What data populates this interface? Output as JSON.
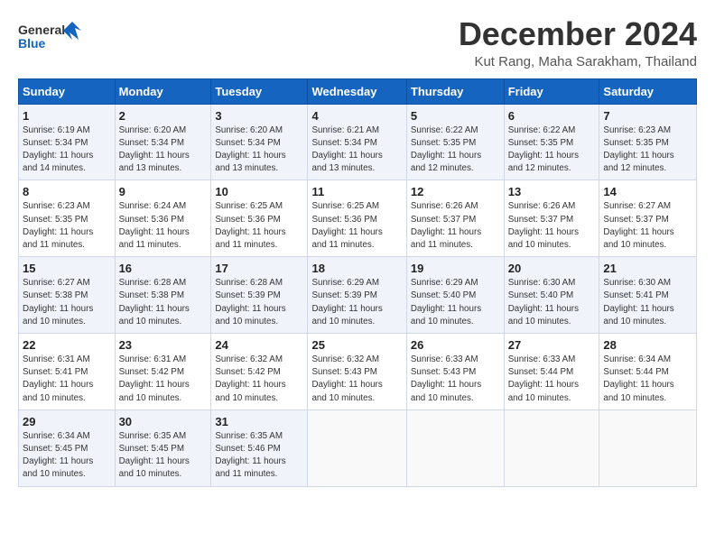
{
  "logo": {
    "line1": "General",
    "line2": "Blue"
  },
  "title": "December 2024",
  "subtitle": "Kut Rang, Maha Sarakham, Thailand",
  "headers": [
    "Sunday",
    "Monday",
    "Tuesday",
    "Wednesday",
    "Thursday",
    "Friday",
    "Saturday"
  ],
  "weeks": [
    [
      {
        "day": "1",
        "rise": "6:19 AM",
        "set": "5:34 PM",
        "daylight": "11 hours and 14 minutes."
      },
      {
        "day": "2",
        "rise": "6:20 AM",
        "set": "5:34 PM",
        "daylight": "11 hours and 13 minutes."
      },
      {
        "day": "3",
        "rise": "6:20 AM",
        "set": "5:34 PM",
        "daylight": "11 hours and 13 minutes."
      },
      {
        "day": "4",
        "rise": "6:21 AM",
        "set": "5:34 PM",
        "daylight": "11 hours and 13 minutes."
      },
      {
        "day": "5",
        "rise": "6:22 AM",
        "set": "5:35 PM",
        "daylight": "11 hours and 12 minutes."
      },
      {
        "day": "6",
        "rise": "6:22 AM",
        "set": "5:35 PM",
        "daylight": "11 hours and 12 minutes."
      },
      {
        "day": "7",
        "rise": "6:23 AM",
        "set": "5:35 PM",
        "daylight": "11 hours and 12 minutes."
      }
    ],
    [
      {
        "day": "8",
        "rise": "6:23 AM",
        "set": "5:35 PM",
        "daylight": "11 hours and 11 minutes."
      },
      {
        "day": "9",
        "rise": "6:24 AM",
        "set": "5:36 PM",
        "daylight": "11 hours and 11 minutes."
      },
      {
        "day": "10",
        "rise": "6:25 AM",
        "set": "5:36 PM",
        "daylight": "11 hours and 11 minutes."
      },
      {
        "day": "11",
        "rise": "6:25 AM",
        "set": "5:36 PM",
        "daylight": "11 hours and 11 minutes."
      },
      {
        "day": "12",
        "rise": "6:26 AM",
        "set": "5:37 PM",
        "daylight": "11 hours and 11 minutes."
      },
      {
        "day": "13",
        "rise": "6:26 AM",
        "set": "5:37 PM",
        "daylight": "11 hours and 10 minutes."
      },
      {
        "day": "14",
        "rise": "6:27 AM",
        "set": "5:37 PM",
        "daylight": "11 hours and 10 minutes."
      }
    ],
    [
      {
        "day": "15",
        "rise": "6:27 AM",
        "set": "5:38 PM",
        "daylight": "11 hours and 10 minutes."
      },
      {
        "day": "16",
        "rise": "6:28 AM",
        "set": "5:38 PM",
        "daylight": "11 hours and 10 minutes."
      },
      {
        "day": "17",
        "rise": "6:28 AM",
        "set": "5:39 PM",
        "daylight": "11 hours and 10 minutes."
      },
      {
        "day": "18",
        "rise": "6:29 AM",
        "set": "5:39 PM",
        "daylight": "11 hours and 10 minutes."
      },
      {
        "day": "19",
        "rise": "6:29 AM",
        "set": "5:40 PM",
        "daylight": "11 hours and 10 minutes."
      },
      {
        "day": "20",
        "rise": "6:30 AM",
        "set": "5:40 PM",
        "daylight": "11 hours and 10 minutes."
      },
      {
        "day": "21",
        "rise": "6:30 AM",
        "set": "5:41 PM",
        "daylight": "11 hours and 10 minutes."
      }
    ],
    [
      {
        "day": "22",
        "rise": "6:31 AM",
        "set": "5:41 PM",
        "daylight": "11 hours and 10 minutes."
      },
      {
        "day": "23",
        "rise": "6:31 AM",
        "set": "5:42 PM",
        "daylight": "11 hours and 10 minutes."
      },
      {
        "day": "24",
        "rise": "6:32 AM",
        "set": "5:42 PM",
        "daylight": "11 hours and 10 minutes."
      },
      {
        "day": "25",
        "rise": "6:32 AM",
        "set": "5:43 PM",
        "daylight": "11 hours and 10 minutes."
      },
      {
        "day": "26",
        "rise": "6:33 AM",
        "set": "5:43 PM",
        "daylight": "11 hours and 10 minutes."
      },
      {
        "day": "27",
        "rise": "6:33 AM",
        "set": "5:44 PM",
        "daylight": "11 hours and 10 minutes."
      },
      {
        "day": "28",
        "rise": "6:34 AM",
        "set": "5:44 PM",
        "daylight": "11 hours and 10 minutes."
      }
    ],
    [
      {
        "day": "29",
        "rise": "6:34 AM",
        "set": "5:45 PM",
        "daylight": "11 hours and 10 minutes."
      },
      {
        "day": "30",
        "rise": "6:35 AM",
        "set": "5:45 PM",
        "daylight": "11 hours and 10 minutes."
      },
      {
        "day": "31",
        "rise": "6:35 AM",
        "set": "5:46 PM",
        "daylight": "11 hours and 11 minutes."
      },
      null,
      null,
      null,
      null
    ]
  ],
  "labels": {
    "sunrise": "Sunrise:",
    "sunset": "Sunset:",
    "daylight": "Daylight:"
  }
}
